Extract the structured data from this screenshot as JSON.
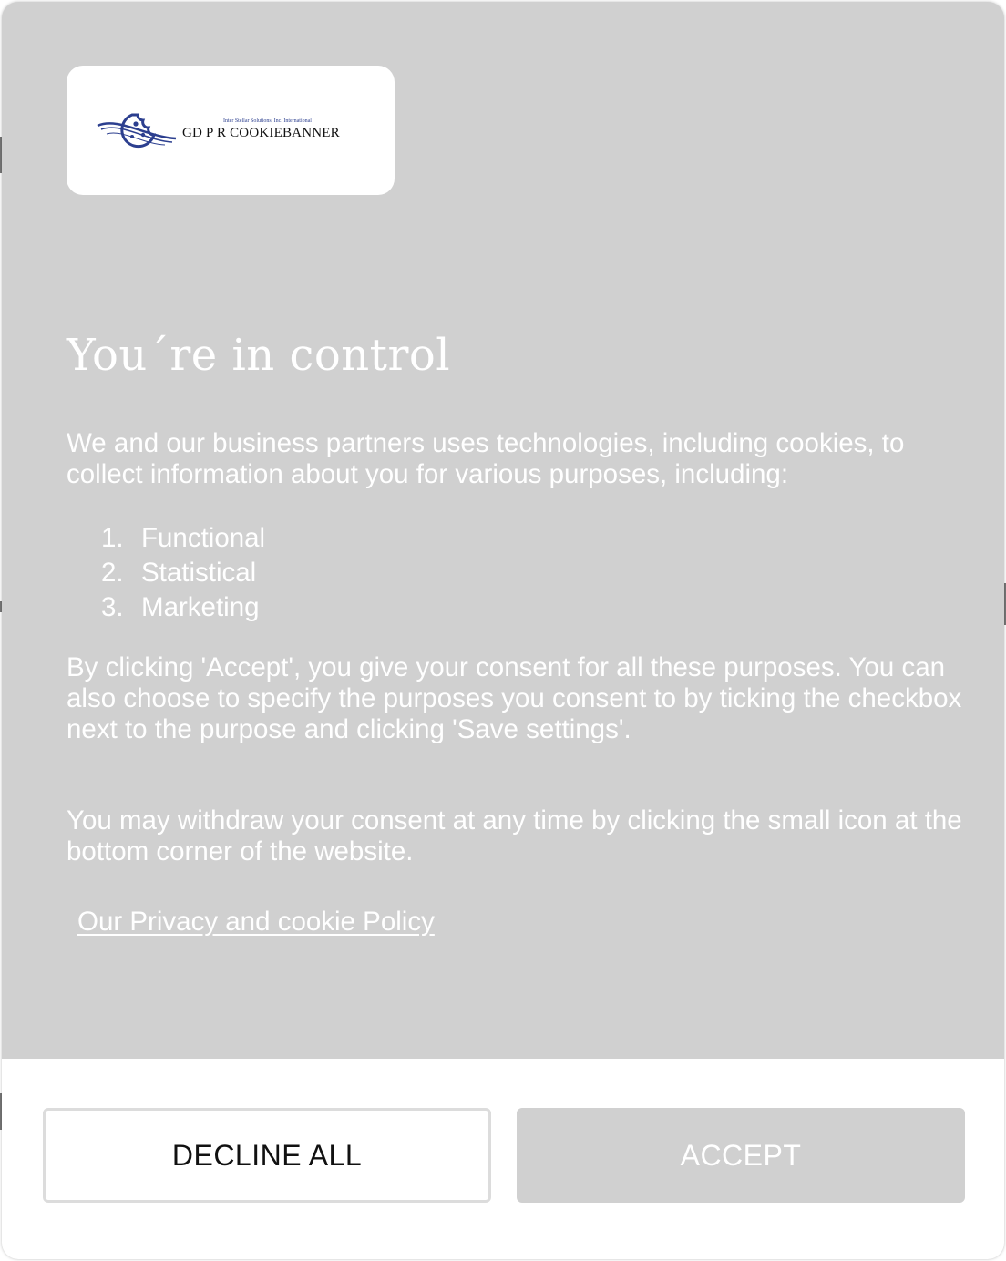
{
  "logo": {
    "tagline": "Inter Stellar Solutions, Inc. International",
    "name": "GD P R  COOKIEBANNER",
    "icon": "cookie-orbit-icon"
  },
  "dialog": {
    "title": "You´re in control",
    "intro": "We and our business partners uses technologies, including cookies, to collect information about you for various purposes, including:",
    "purposes": [
      {
        "number": "1.",
        "label": "Functional"
      },
      {
        "number": "2.",
        "label": "Statistical"
      },
      {
        "number": "3.",
        "label": "Marketing"
      }
    ],
    "consent_text": "By clicking 'Accept', you give your consent for all these purposes. You can also choose to specify the purposes you consent to by ticking the checkbox next to the purpose and clicking 'Save settings'.",
    "withdraw_text": "You may withdraw your consent at any time by clicking the small icon at the bottom corner of the website.",
    "policy_link": "Our Privacy and cookie Policy"
  },
  "buttons": {
    "decline": "DECLINE ALL",
    "accept": "ACCEPT"
  },
  "colors": {
    "overlay": "#d0d0d0",
    "text": "#ffffff",
    "logo_blue": "#2c3f8f"
  }
}
